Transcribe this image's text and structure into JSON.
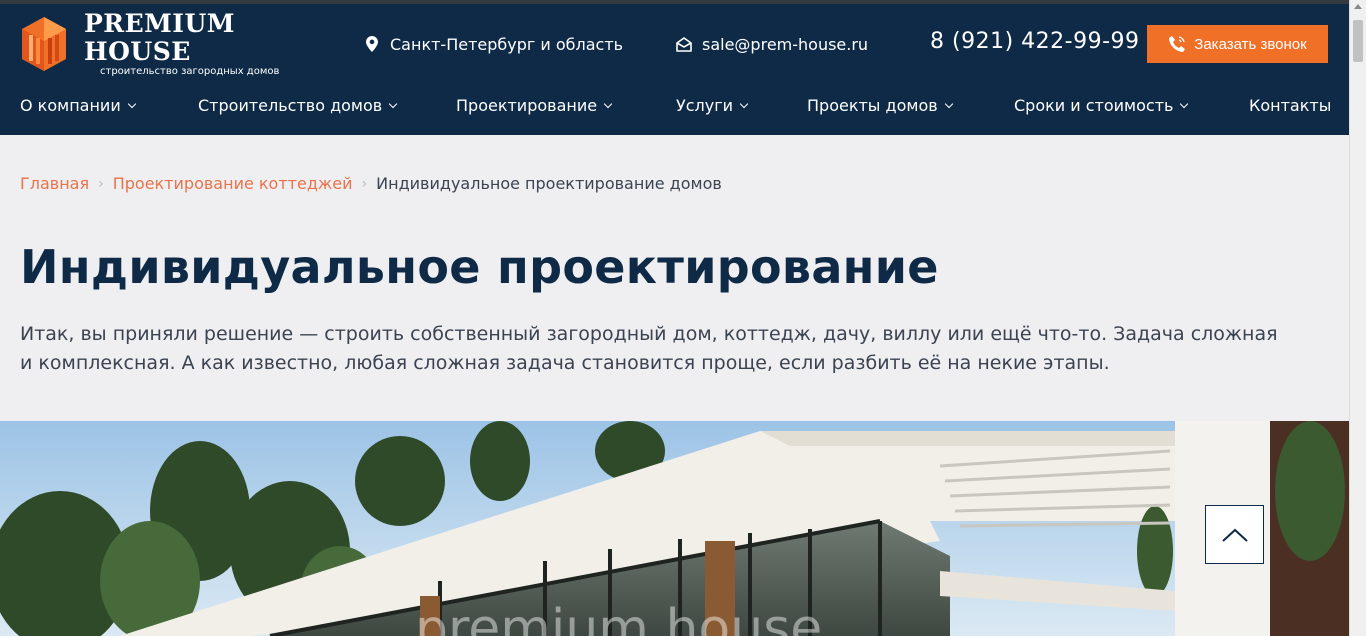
{
  "brand": {
    "title": "PREMIUM HOUSE",
    "subtitle": "строительство загородных домов"
  },
  "header": {
    "location": "Санкт-Петербург и область",
    "email": "sale@prem-house.ru",
    "phone": "8 (921) 422-99-99",
    "call_button": "Заказать звонок"
  },
  "nav": {
    "items": [
      {
        "label": "О компании",
        "has_dropdown": true
      },
      {
        "label": "Строительство домов",
        "has_dropdown": true
      },
      {
        "label": "Проектирование",
        "has_dropdown": true
      },
      {
        "label": "Услуги",
        "has_dropdown": true
      },
      {
        "label": "Проекты домов",
        "has_dropdown": true
      },
      {
        "label": "Сроки и стоимость",
        "has_dropdown": true
      },
      {
        "label": "Контакты",
        "has_dropdown": false
      }
    ]
  },
  "breadcrumb": {
    "home": "Главная",
    "section": "Проектирование коттеджей",
    "current": "Индивидуальное проектирование домов"
  },
  "page": {
    "title": "Индивидуальное проектирование",
    "intro_line1": "Итак, вы приняли решение — строить собственный загородный дом, коттедж, дачу, виллу или ещё что-то. Задача сложная",
    "intro_line2": "и комплексная. А как известно, любая сложная задача становится проще, если разбить её на некие этапы.",
    "watermark": "premium house"
  },
  "colors": {
    "header_bg": "#0e2a47",
    "accent": "#f07028",
    "page_bg": "#efeff2",
    "link": "#e8734a"
  },
  "icons": {
    "location": "map-pin-icon",
    "email": "envelope-open-icon",
    "call": "phone-volume-icon",
    "scroll_top": "chevron-up-icon"
  }
}
